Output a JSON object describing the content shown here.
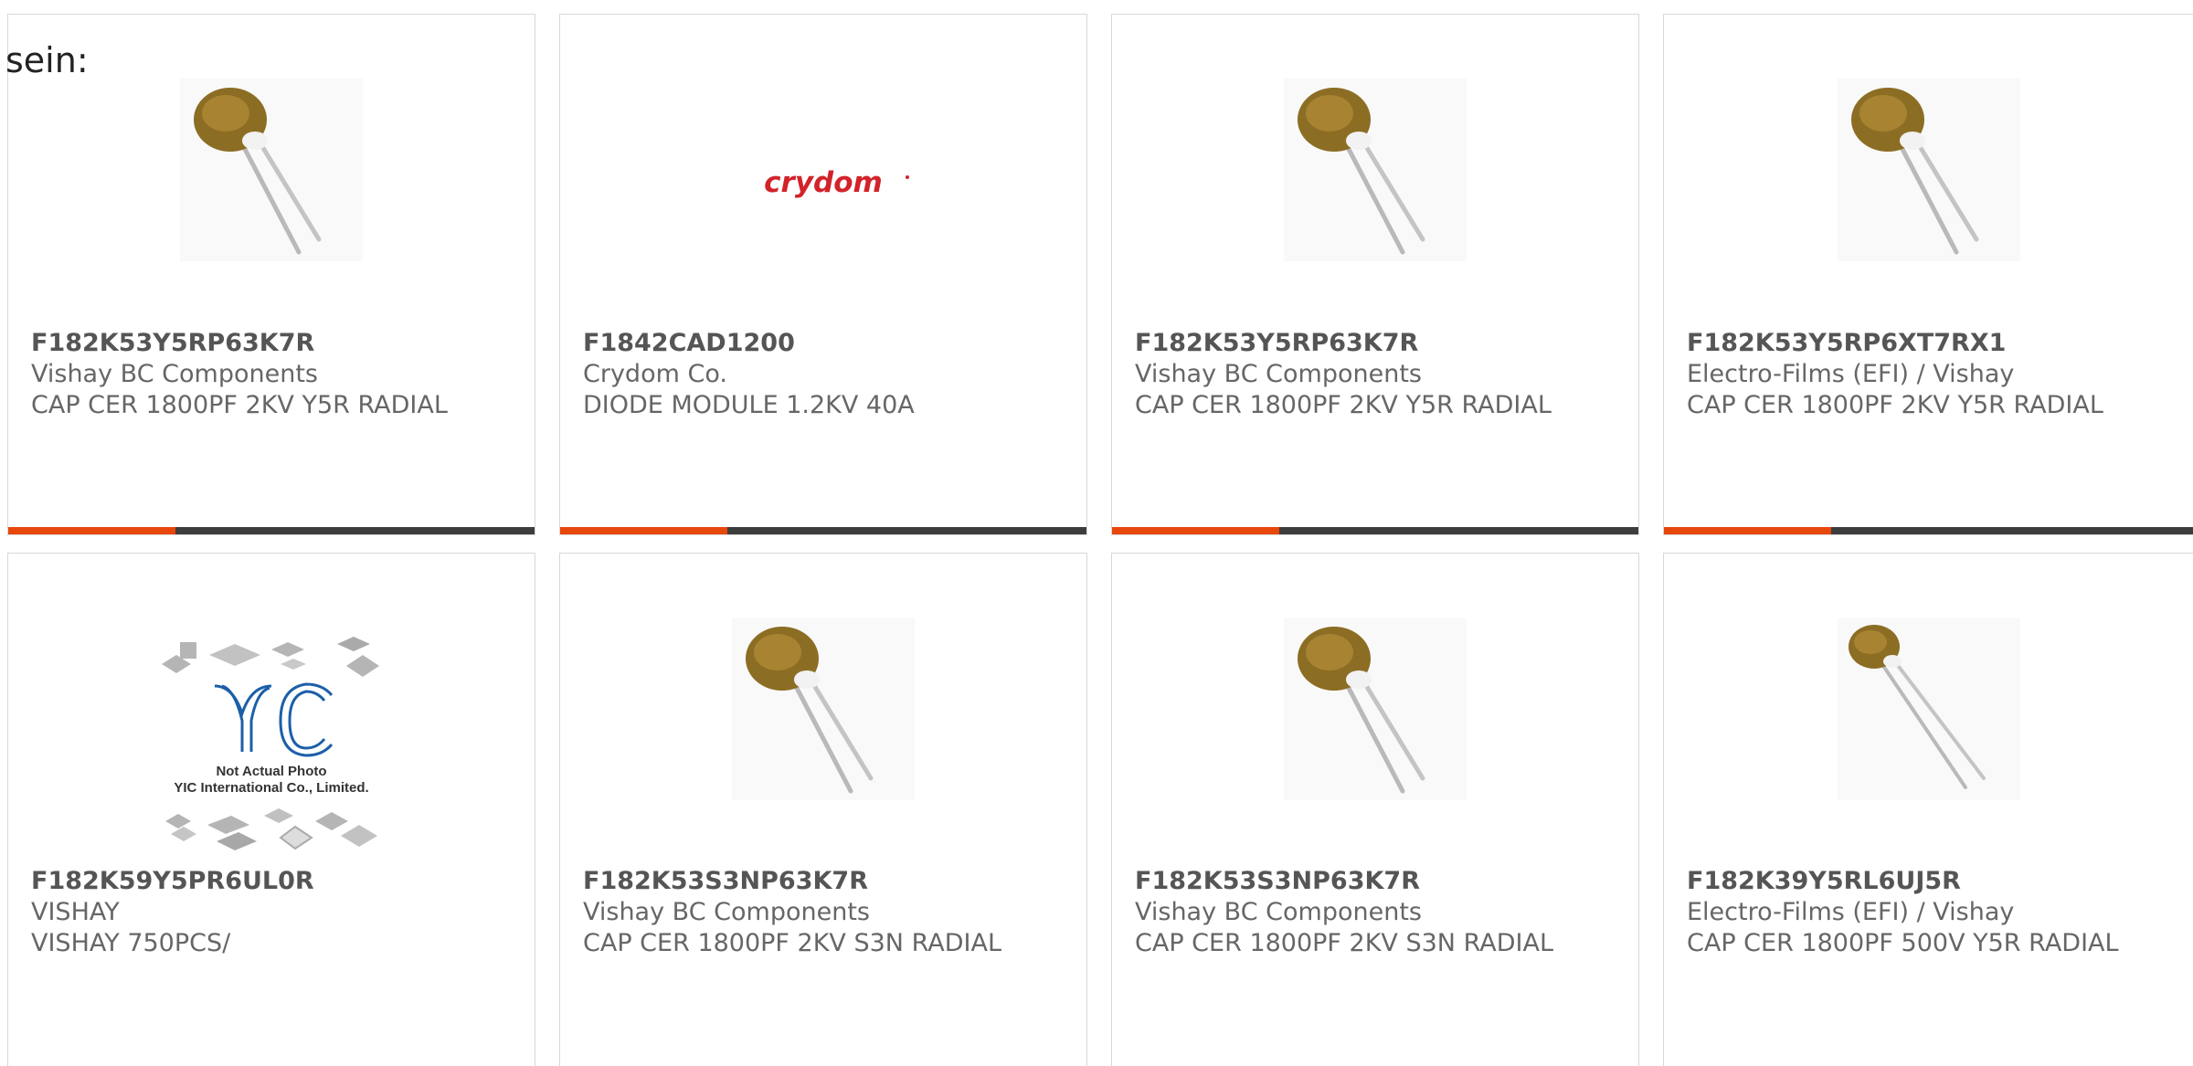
{
  "intro_text": "sein:",
  "colors": {
    "accent": "#e8470b",
    "bar": "#3d3d3d",
    "text": "#666666",
    "part": "#555555"
  },
  "cards": [
    {
      "part": "F182K53Y5RP63K7R",
      "maker": "Vishay BC Components",
      "desc": "CAP CER 1800PF 2KV Y5R RADIAL",
      "image": "ceramic-capacitor-icon"
    },
    {
      "part": "F1842CAD1200",
      "maker": "Crydom Co.",
      "desc": "DIODE MODULE 1.2KV 40A",
      "image": "crydom-logo",
      "logo_text": "crydom"
    },
    {
      "part": "F182K53Y5RP63K7R",
      "maker": "Vishay BC Components",
      "desc": "CAP CER 1800PF 2KV Y5R RADIAL",
      "image": "ceramic-capacitor-icon"
    },
    {
      "part": "F182K53Y5RP6XT7RX1",
      "maker": "Electro-Films (EFI) / Vishay",
      "desc": "CAP CER 1800PF 2KV Y5R RADIAL",
      "image": "ceramic-capacitor-icon"
    },
    {
      "part": "F182K59Y5PR6UL0R",
      "maker": "VISHAY",
      "desc": "VISHAY 750PCS/",
      "image": "not-actual-photo-placeholder",
      "placeholder_line1": "Not Actual Photo",
      "placeholder_line2": "YIC International Co., Limited."
    },
    {
      "part": "F182K53S3NP63K7R",
      "maker": "Vishay BC Components",
      "desc": "CAP CER 1800PF 2KV S3N RADIAL",
      "image": "ceramic-capacitor-icon"
    },
    {
      "part": "F182K53S3NP63K7R",
      "maker": "Vishay BC Components",
      "desc": "CAP CER 1800PF 2KV S3N RADIAL",
      "image": "ceramic-capacitor-icon"
    },
    {
      "part": "F182K39Y5RL6UJ5R",
      "maker": "Electro-Films (EFI) / Vishay",
      "desc": "CAP CER 1800PF 500V Y5R RADIAL",
      "image": "ceramic-capacitor-small-icon"
    }
  ]
}
